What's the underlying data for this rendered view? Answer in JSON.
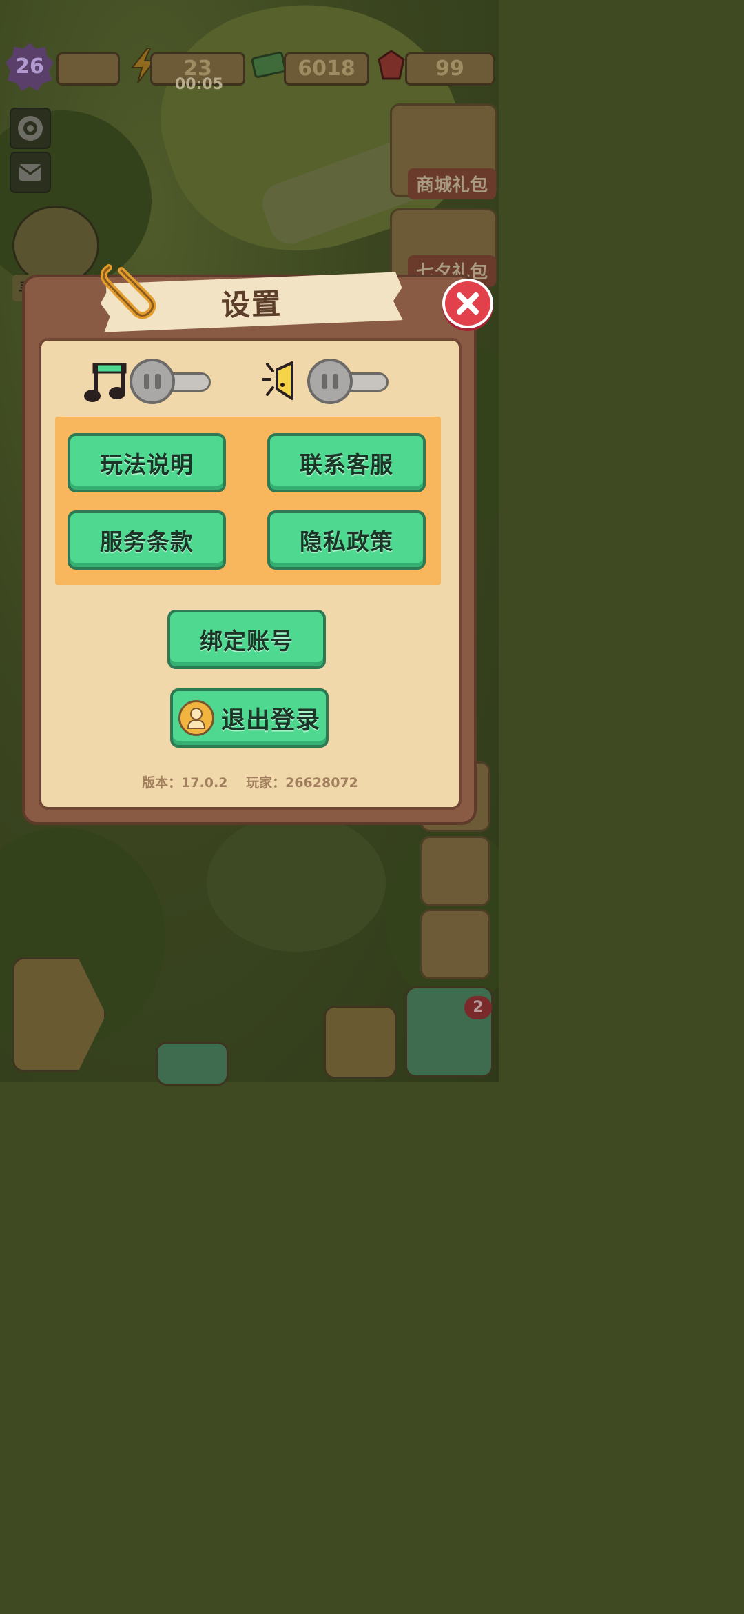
{
  "hud": {
    "level": "26",
    "energy": "23",
    "energy_timer": "00:05",
    "cash": "6018",
    "gems": "99"
  },
  "background": {
    "shop_pack_label": "商城礼包",
    "qixi_pack_label": "七夕礼包",
    "find_items_label": "寻物玩法",
    "star_badge_count": "2"
  },
  "modal": {
    "title": "设置",
    "toggles": {
      "music_icon": "music-note-icon",
      "sound_icon": "speaker-icon"
    },
    "buttons": {
      "how_to_play": "玩法说明",
      "contact_support": "联系客服",
      "terms_of_service": "服务条款",
      "privacy_policy": "隐私政策",
      "bind_account": "绑定账号",
      "logout": "退出登录"
    },
    "footer": {
      "version": "版本：17.0.2",
      "player": "玩家：26628072"
    }
  },
  "colors": {
    "accent_green": "#4fd890",
    "panel_bg": "#f0d8aa",
    "frame_brown": "#8a5b44",
    "close_red": "#e2404b",
    "orange_box": "#f9b75d"
  }
}
